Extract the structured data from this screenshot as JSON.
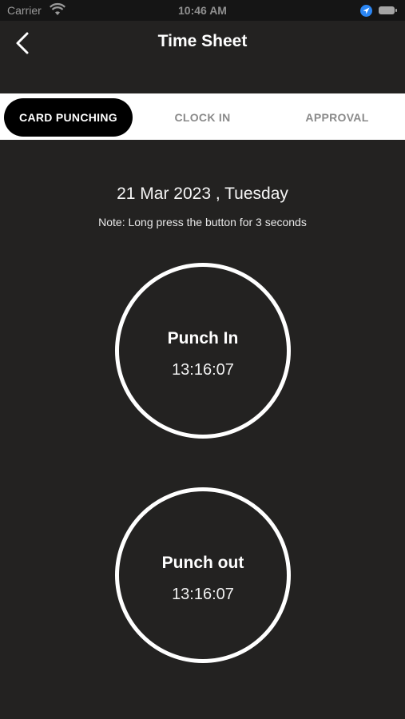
{
  "status_bar": {
    "carrier": "Carrier",
    "time": "10:46 AM"
  },
  "nav": {
    "title": "Time Sheet"
  },
  "tabs": [
    {
      "label": "CARD PUNCHING",
      "active": true
    },
    {
      "label": "CLOCK IN",
      "active": false
    },
    {
      "label": "APPROVAL",
      "active": false
    }
  ],
  "main": {
    "date": "21 Mar 2023 , Tuesday",
    "note": "Note: Long press the button for 3 seconds",
    "punch_in": {
      "label": "Punch In",
      "time": "13:16:07"
    },
    "punch_out": {
      "label": "Punch out",
      "time": "13:16:07"
    }
  },
  "icons": {
    "back": "chevron-left-icon",
    "wifi": "wifi-icon",
    "location": "location-arrow-icon",
    "battery": "battery-icon"
  },
  "colors": {
    "background": "#232221",
    "status_bar": "#151515",
    "tab_bar": "#ffffff",
    "tab_active_bg": "#000000",
    "tab_inactive_text": "#8a8a8a",
    "location_accent": "#2b86f3"
  }
}
